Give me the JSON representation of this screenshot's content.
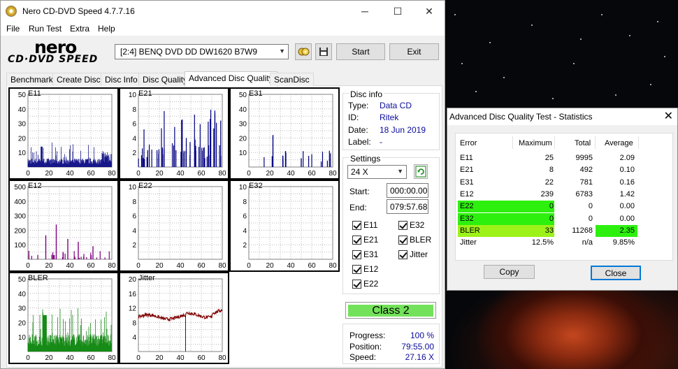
{
  "window": {
    "title": "Nero CD-DVD Speed 4.7.7.16",
    "minimize_glyph": "─",
    "maximize_glyph": "☐",
    "close_glyph": "✕"
  },
  "menu": [
    "File",
    "Run Test",
    "Extra",
    "Help"
  ],
  "logo": {
    "line1": "nero",
    "line2": "CD·DVD SPEED"
  },
  "toolbar": {
    "drive": "[2:4]   BENQ DVD DD DW1620 B7W9",
    "start_label": "Start",
    "exit_label": "Exit",
    "icons": [
      "eject-drive-icon",
      "save-icon"
    ]
  },
  "tabs": [
    "Benchmark",
    "Create Disc",
    "Disc Info",
    "Disc Quality",
    "Advanced Disc Quality",
    "ScanDisc"
  ],
  "active_tab": "Advanced Disc Quality",
  "graphs": [
    {
      "name": "E11",
      "yticks": [
        "50",
        "40",
        "30",
        "20",
        "10"
      ],
      "ymax": 50
    },
    {
      "name": "E21",
      "yticks": [
        "10",
        "8",
        "6",
        "4",
        "2"
      ],
      "ymax": 10
    },
    {
      "name": "E31",
      "yticks": [
        "50",
        "40",
        "30",
        "20",
        "10"
      ],
      "ymax": 50
    },
    {
      "name": "E12",
      "yticks": [
        "500",
        "400",
        "300",
        "200",
        "100"
      ],
      "ymax": 500
    },
    {
      "name": "E22",
      "yticks": [
        "10",
        "8",
        "6",
        "4",
        "2"
      ],
      "ymax": 10
    },
    {
      "name": "E32",
      "yticks": [
        "10",
        "8",
        "6",
        "4",
        "2"
      ],
      "ymax": 10
    },
    {
      "name": "BLER",
      "yticks": [
        "50",
        "40",
        "30",
        "20",
        "10"
      ],
      "ymax": 50
    },
    {
      "name": "Jitter",
      "yticks": [
        "20",
        "16",
        "12",
        "8",
        "4"
      ],
      "ymax": 20
    }
  ],
  "xticks": [
    "0",
    "20",
    "40",
    "60",
    "80"
  ],
  "disc_info": {
    "title": "Disc info",
    "rows": [
      {
        "k": "Type:",
        "v": "Data CD"
      },
      {
        "k": "ID:",
        "v": "Ritek"
      },
      {
        "k": "Date:",
        "v": "18 Jun 2019"
      },
      {
        "k": "Label:",
        "v": "-"
      }
    ]
  },
  "settings": {
    "title": "Settings",
    "speed": "24 X",
    "start_label": "Start:",
    "start_value": "000:00.00",
    "end_label": "End:",
    "end_value": "079:57.68",
    "checkboxes_left": [
      "E11",
      "E21",
      "E31",
      "E12",
      "E22"
    ],
    "checkboxes_right": [
      "E32",
      "BLER",
      "Jitter"
    ]
  },
  "class_label": "Class 2",
  "progress": {
    "rows": [
      {
        "k": "Progress:",
        "v": "100 %"
      },
      {
        "k": "Position:",
        "v": "79:55.00"
      },
      {
        "k": "Speed:",
        "v": "27.16 X"
      }
    ]
  },
  "stats": {
    "title": "Advanced Disc Quality Test - Statistics",
    "headers": [
      "Error",
      "Maximum",
      "Total",
      "Average"
    ],
    "rows": [
      {
        "error": "E11",
        "max": "25",
        "total": "9995",
        "avg": "2.09"
      },
      {
        "error": "E21",
        "max": "8",
        "total": "492",
        "avg": "0.10"
      },
      {
        "error": "E31",
        "max": "22",
        "total": "781",
        "avg": "0.16"
      },
      {
        "error": "E12",
        "max": "239",
        "total": "6783",
        "avg": "1.42"
      },
      {
        "error": "E22",
        "max": "0",
        "total": "0",
        "avg": "0.00"
      },
      {
        "error": "E32",
        "max": "0",
        "total": "0",
        "avg": "0.00"
      },
      {
        "error": "BLER",
        "max": "33",
        "total": "11268",
        "avg": "2.35"
      },
      {
        "error": "Jitter",
        "max": "12.5%",
        "total": "n/a",
        "avg": "9.85%"
      }
    ],
    "copy_label": "Copy",
    "close_label": "Close",
    "highlight_colors": {
      "zero_rows": "#2ef00f",
      "bler_max": "#9df21a",
      "bler_avg": "#2ef00f"
    }
  },
  "colors": {
    "e11": "#000080",
    "e12": "#800080",
    "bler": "#008000",
    "jitter": "#800000"
  }
}
